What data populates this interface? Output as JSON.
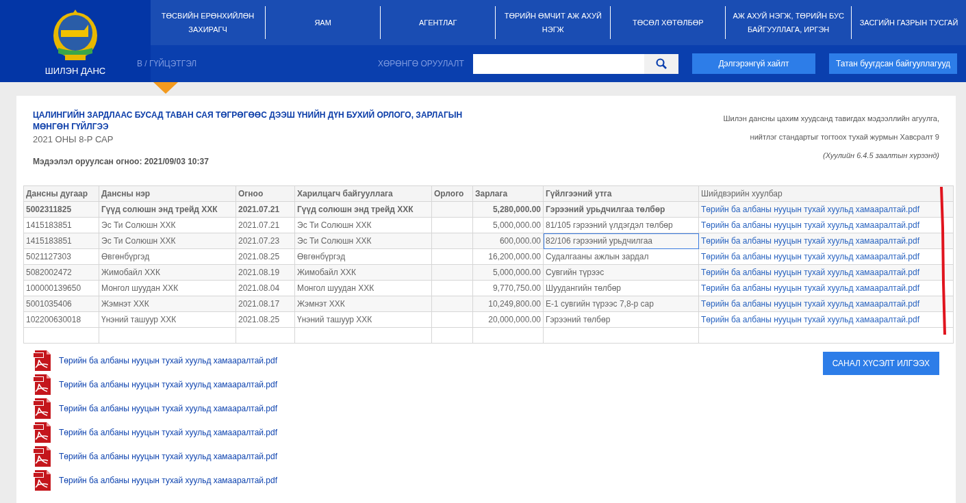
{
  "header": {
    "logo_label": "ШИЛЭН ДАНС",
    "background_texts": [
      "В / ГҮЙЦЭТГЭЛ",
      "ХӨРӨНГӨ ОРУУЛАЛТ"
    ],
    "nav": [
      {
        "label": "ТӨСВИЙН ЕРӨНХИЙЛӨН ЗАХИРАГЧ",
        "selected": true
      },
      {
        "label": "ЯАМ",
        "selected": false
      },
      {
        "label": "АГЕНТЛАГ",
        "selected": false
      },
      {
        "label": "ТӨРИЙН ӨМЧИТ АЖ АХУЙ НЭГЖ",
        "selected": false
      },
      {
        "label": "ТӨСӨЛ ХӨТӨЛБӨР",
        "selected": false
      },
      {
        "label": "АЖ АХУЙ НЭГЖ, ТӨРИЙН БУС БАЙГУУЛЛАГА, ИРГЭН",
        "selected": false
      },
      {
        "label": "ЗАСГИЙН ГАЗРЫН ТУСГАЙ",
        "selected": false
      }
    ],
    "buttons": [
      "Дэлгэрэнгүй хайлт",
      "Татан буугдсан байгууллагууд"
    ]
  },
  "report": {
    "title": "ЦАЛИНГИЙН ЗАРДЛААС БУСАД ТАВАН САЯ ТӨГРӨГӨӨС ДЭЭШ ҮНИЙН ДҮН БУХИЙ ОРЛОГО, ЗАРЛАГЫН МӨНГӨН ГҮЙЛГЭЭ",
    "period": "2021 ОНЫ 8-Р САР",
    "updated": "Мэдээлэл оруулсан огноо: 2021/09/03 10:37",
    "note_lines": [
      "Шилэн дансны цахим хуудсанд тавигдах мэдээллийн агуулга,",
      "нийтлэг стандартыг тогтоох тухай журмын Хавсралт 9"
    ],
    "note_law": "(Хуулийн 6.4.5 заалтын хүрээнд)"
  },
  "table": {
    "columns": [
      "Дансны дугаар",
      "Дансны нэр",
      "Огноо",
      "Харилцагч байгууллага",
      "Орлого",
      "Зарлага",
      "Гүйлгээний утга",
      "Шийдвэрийн хуулбар"
    ],
    "rows": [
      {
        "bold": true,
        "focused": false,
        "cells": [
          "5002311825",
          "Гүүд солюшн энд трейд ХХК",
          "2021.07.21",
          "Гүүд солюшн энд трейд ХХК",
          "",
          "5,280,000.00",
          "Гэрээний урьдчилгаа төлбөр",
          "Төрийн ба албаны нууцын тухай хуульд хамааралтай.pdf"
        ]
      },
      {
        "bold": false,
        "focused": false,
        "cells": [
          "1415183851",
          "Эс Ти Солюшн ХХК",
          "2021.07.21",
          "Эс Ти Солюшн ХХК",
          "",
          "5,000,000.00",
          "81/105 гэрээний үлдэгдэл төлбөр",
          "Төрийн ба албаны нууцын тухай хуульд хамааралтай.pdf"
        ]
      },
      {
        "bold": false,
        "focused": true,
        "cells": [
          "1415183851",
          "Эс Ти Солюшн ХХК",
          "2021.07.23",
          "Эс Ти Солюшн ХХК",
          "",
          "600,000.00",
          "82/106 гэрээний урьдчилгаа",
          "Төрийн ба албаны нууцын тухай хуульд хамааралтай.pdf"
        ]
      },
      {
        "bold": false,
        "focused": false,
        "cells": [
          "5021127303",
          "Өвгөнбүргэд",
          "2021.08.25",
          "Өвгөнбүргэд",
          "",
          "16,200,000.00",
          "Судалгааны ажлын зардал",
          "Төрийн ба албаны нууцын тухай хуульд хамааралтай.pdf"
        ]
      },
      {
        "bold": false,
        "focused": false,
        "cells": [
          "5082002472",
          "Жимобайл ХХК",
          "2021.08.19",
          "Жимобайл ХХК",
          "",
          "5,000,000.00",
          "Сувгийн түрээс",
          "Төрийн ба албаны нууцын тухай хуульд хамааралтай.pdf"
        ]
      },
      {
        "bold": false,
        "focused": false,
        "cells": [
          "100000139650",
          "Монгол шуудан ХХК",
          "2021.08.04",
          "Монгол шуудан ХХК",
          "",
          "9,770,750.00",
          "Шуудангийн төлбөр",
          "Төрийн ба албаны нууцын тухай хуульд хамааралтай.pdf"
        ]
      },
      {
        "bold": false,
        "focused": false,
        "cells": [
          "5001035406",
          "Жэмнэт ХХК",
          "2021.08.17",
          "Жэмнэт ХХК",
          "",
          "10,249,800.00",
          "Е-1 сувгийн түрээс 7,8-р сар",
          "Төрийн ба албаны нууцын тухай хуульд хамааралтай.pdf"
        ]
      },
      {
        "bold": false,
        "focused": false,
        "cells": [
          "102200630018",
          "Үнэний ташуур ХХК",
          "2021.08.25",
          "Үнэний ташуур ХХК",
          "",
          "20,000,000.00",
          "Гэрээний төлбөр",
          "Төрийн ба албаны нууцын тухай хуульд хамааралтай.pdf"
        ]
      }
    ]
  },
  "attachments": [
    "Төрийн ба албаны нууцын тухай хуульд хамааралтай.pdf",
    "Төрийн ба албаны нууцын тухай хуульд хамааралтай.pdf",
    "Төрийн ба албаны нууцын тухай хуульд хамааралтай.pdf",
    "Төрийн ба албаны нууцын тухай хуульд хамааралтай.pdf",
    "Төрийн ба албаны нууцын тухай хуульд хамааралтай.pdf",
    "Төрийн ба албаны нууцын тухай хуульд хамааралтай.pdf"
  ],
  "feedback_button": "САНАЛ ХҮСЭЛТ ИЛГЭЭХ"
}
